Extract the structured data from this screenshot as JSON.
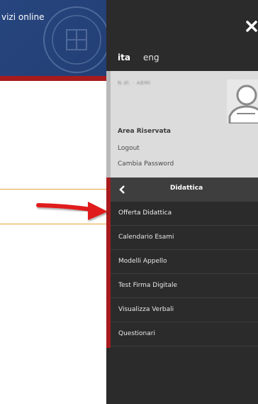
{
  "background": {
    "site_title": "vizi online"
  },
  "drawer": {
    "languages": [
      "ita",
      "eng"
    ],
    "user": {
      "blurred_name": "N.dl. · ABMI",
      "area_label": "Area Riservata",
      "logout_label": "Logout",
      "change_password_label": "Cambia Password"
    },
    "menu": {
      "title": "Didattica",
      "items": [
        "Offerta Didattica",
        "Calendario Esami",
        "Modelli Appello",
        "Test Firma Digitale",
        "Visualizza Verbali",
        "Questionari"
      ]
    }
  },
  "colors": {
    "header_blue": "#27457e",
    "accent_red": "#a71b1d",
    "drawer_dark": "#2b2b2b",
    "orange_line": "#e8a339"
  }
}
